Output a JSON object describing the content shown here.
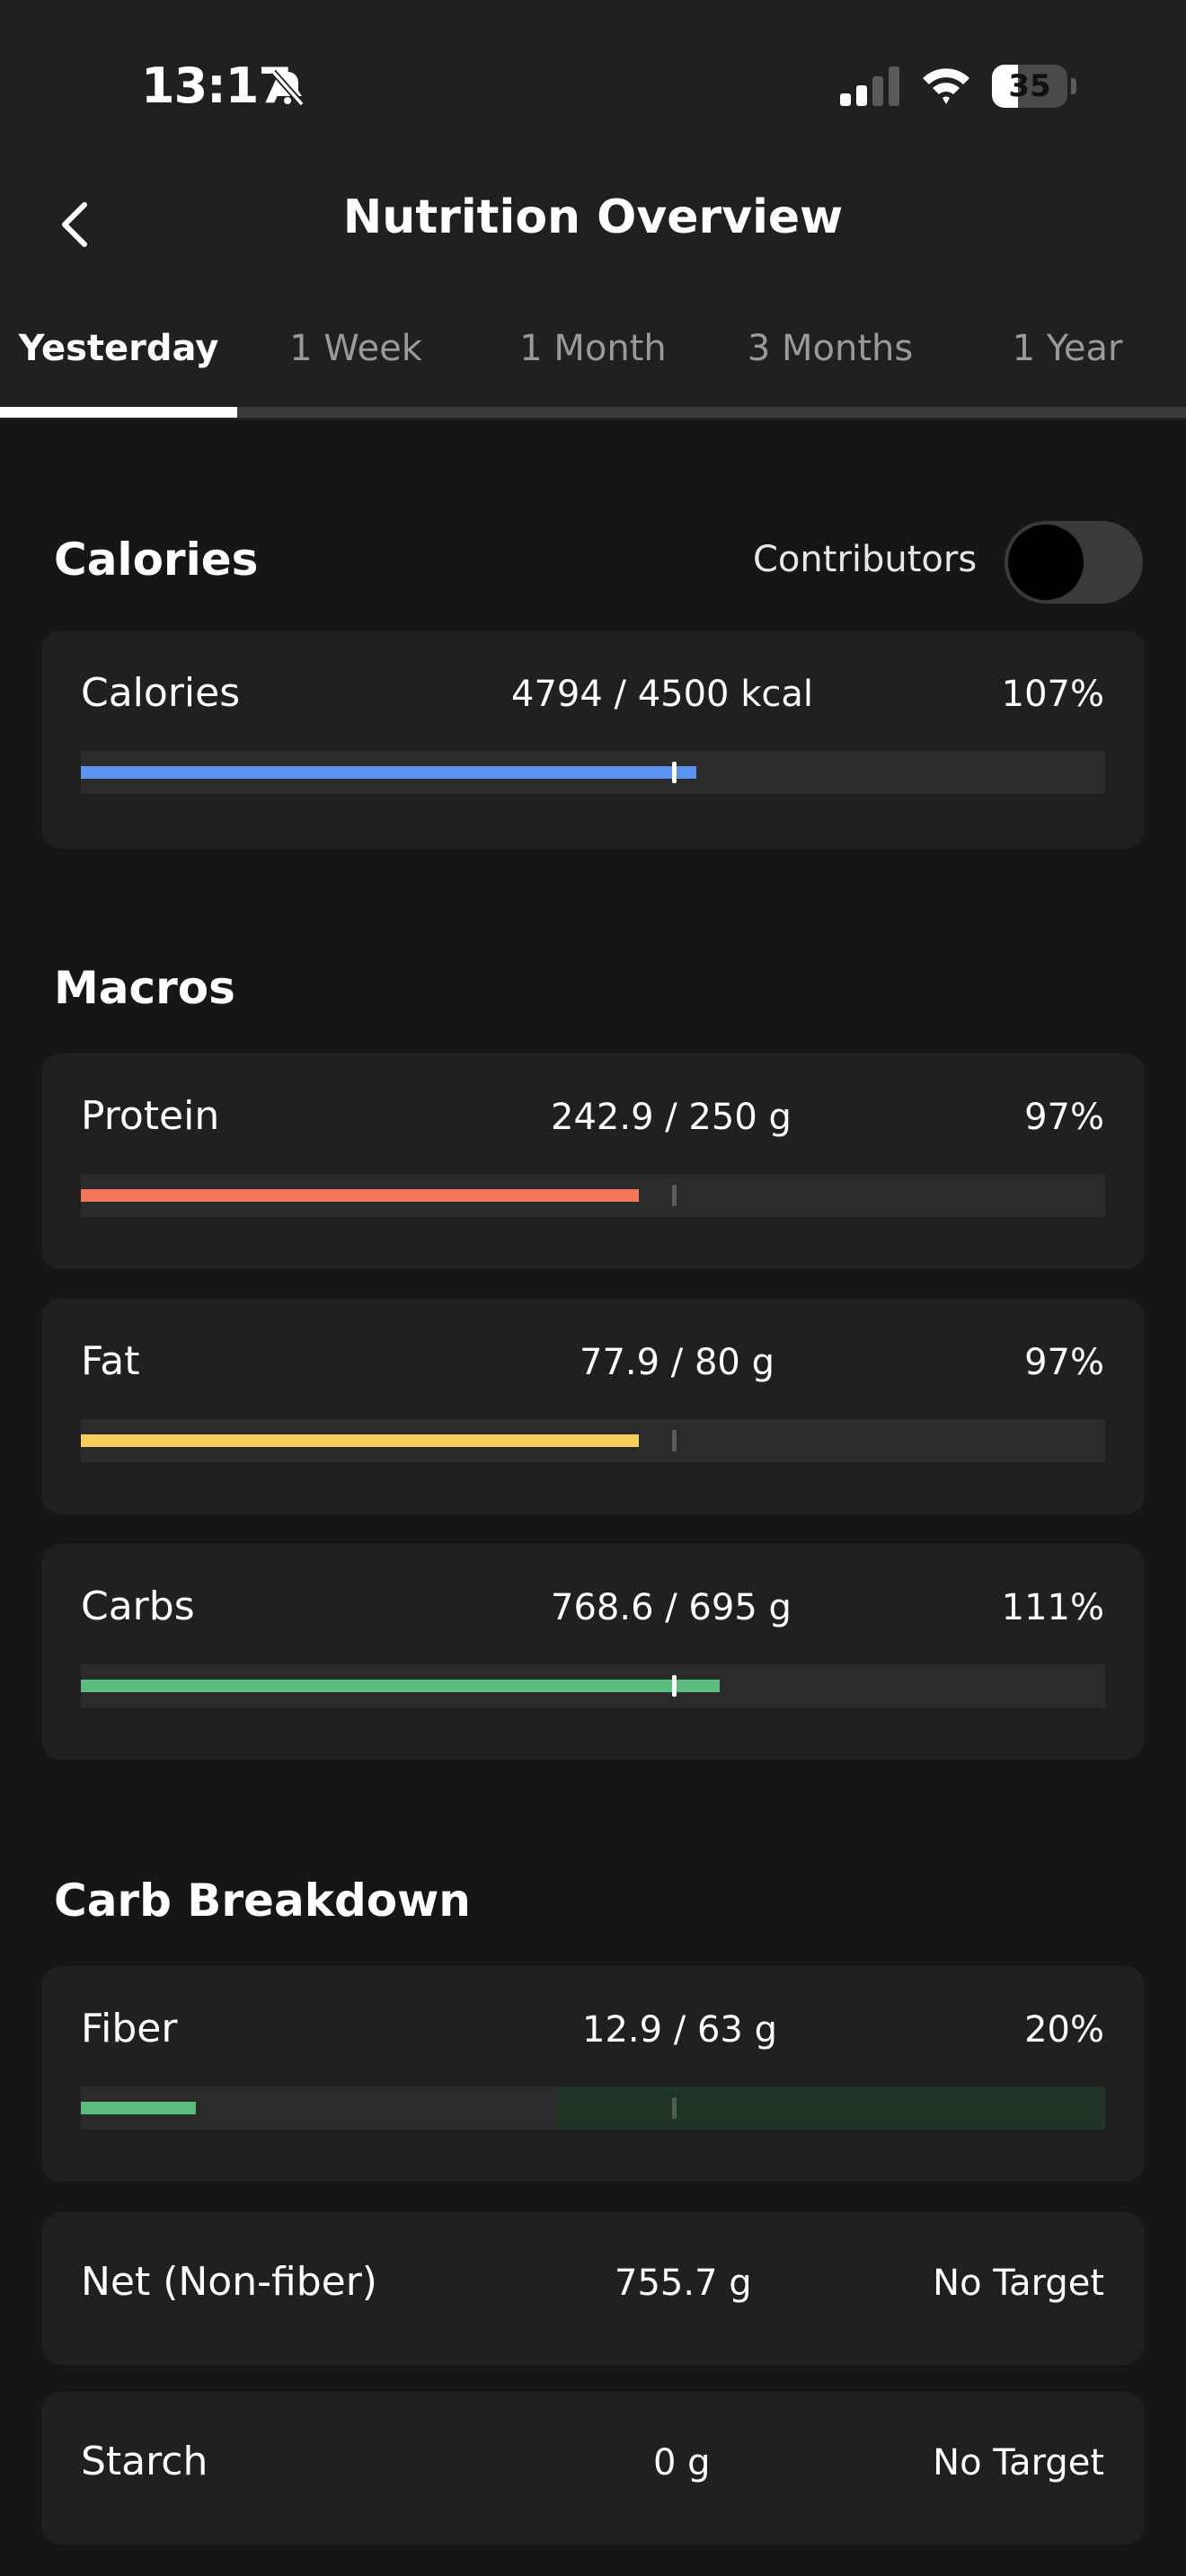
{
  "status_bar": {
    "time": "13:17",
    "battery": "35"
  },
  "header": {
    "title": "Nutrition Overview"
  },
  "tabs": [
    {
      "label": "Yesterday",
      "active": true
    },
    {
      "label": "1 Week",
      "active": false
    },
    {
      "label": "1 Month",
      "active": false
    },
    {
      "label": "3 Months",
      "active": false
    },
    {
      "label": "1 Year",
      "active": false
    }
  ],
  "calories_section": {
    "title": "Calories",
    "contributors_label": "Contributors",
    "contributors_enabled": false,
    "card": {
      "label": "Calories",
      "value": "4794 / 4500 kcal",
      "percent": "107%",
      "progress": 1.07,
      "color": "#5b94f0"
    }
  },
  "macros_section": {
    "title": "Macros",
    "items": [
      {
        "label": "Protein",
        "value": "242.9 / 250 g",
        "percent": "97%",
        "progress": 0.97,
        "color": "#f3775a"
      },
      {
        "label": "Fat",
        "value": "77.9 / 80 g",
        "percent": "97%",
        "progress": 0.97,
        "color": "#f7cd5b"
      },
      {
        "label": "Carbs",
        "value": "768.6 / 695 g",
        "percent": "111%",
        "progress": 1.11,
        "color": "#5abd7d"
      }
    ]
  },
  "carb_breakdown_section": {
    "title": "Carb Breakdown",
    "fiber": {
      "label": "Fiber",
      "value": "12.9 / 63 g",
      "percent": "20%",
      "progress": 0.2,
      "color": "#5abd7d",
      "target_zone_start": 0.8
    },
    "net": {
      "label": "Net (Non-fiber)",
      "value": "755.7 g",
      "target": "No Target"
    },
    "starch": {
      "label": "Starch",
      "value": "0 g",
      "target": "No Target"
    }
  }
}
